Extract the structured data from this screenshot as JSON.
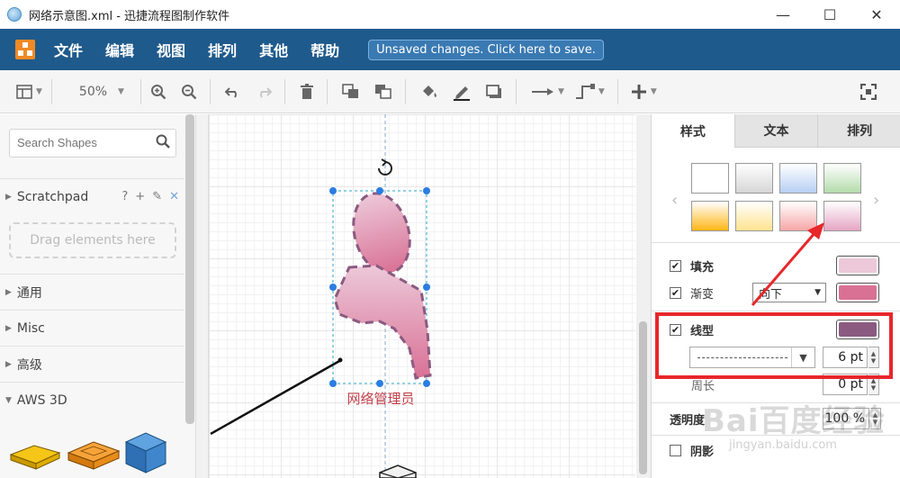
{
  "window": {
    "title": "网络示意图.xml - 迅捷流程图制作软件",
    "minimize": "—",
    "maximize": "☐",
    "close": "✕"
  },
  "menu": {
    "items": [
      "文件",
      "编辑",
      "视图",
      "排列",
      "其他",
      "帮助"
    ],
    "save_notice": "Unsaved changes. Click here to save."
  },
  "toolbar": {
    "zoom": "50%"
  },
  "left_panel": {
    "search_placeholder": "Search Shapes",
    "scratchpad_title": "Scratchpad",
    "scratchpad_help": "?",
    "dropzone_text": "Drag elements here",
    "sections": [
      "通用",
      "Misc",
      "高级",
      "AWS 3D"
    ]
  },
  "canvas": {
    "shape_label": "网络管理员"
  },
  "right_panel": {
    "tabs": [
      "样式",
      "文本",
      "排列"
    ],
    "swatch_colors": [
      "#ffffff",
      "#d6d6d6",
      "#b7cff3",
      "#b3dcab",
      "#ffb616",
      "#ffe38f",
      "#f7a6a6",
      "#e6a5c4"
    ],
    "fill_label": "填充",
    "fill_color": "#ecc8d8",
    "gradient_label": "渐变",
    "gradient_direction": "向下",
    "gradient_color": "#d97195",
    "line_label": "线型",
    "line_color": "#8b5a80",
    "line_width": "6 pt",
    "perimeter_label": "周长",
    "perimeter_value": "0 pt",
    "opacity_label": "透明度",
    "opacity_value": "100 %",
    "shadow_label": "阴影"
  },
  "watermark": {
    "brand": "Bai百度经验",
    "url": "jingyan.baidu.com"
  }
}
